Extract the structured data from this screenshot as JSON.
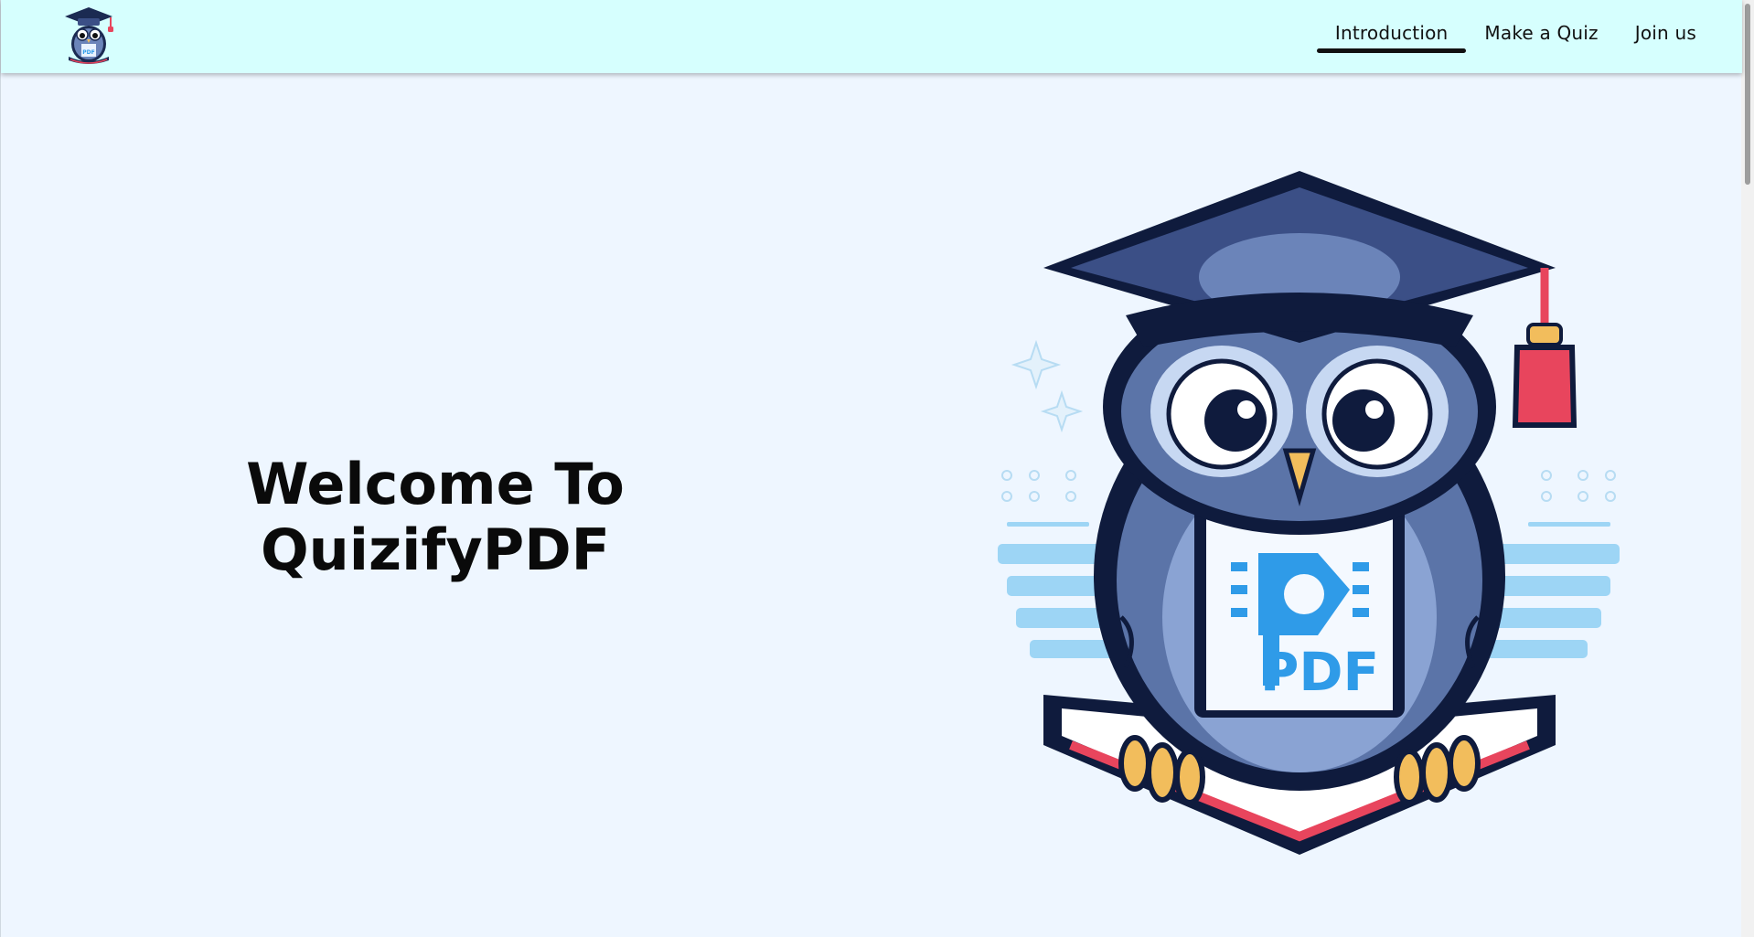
{
  "brand": {
    "logo_icon": "owl-graduate-pdf-logo",
    "logo_text": "PDF"
  },
  "nav": {
    "items": [
      {
        "label": "Introduction",
        "active": true
      },
      {
        "label": "Make a Quiz",
        "active": false
      },
      {
        "label": "Join us",
        "active": false
      }
    ]
  },
  "hero": {
    "title_line1": "Welcome To",
    "title_line2": "QuizifyPDF",
    "illustration_icon": "owl-graduate-reading-pdf-illustration",
    "illustration_text": "PDF"
  },
  "colors": {
    "header_bg": "#d6fffe",
    "page_bg": "#eef6ff",
    "navy": "#0f1b3d",
    "owl_blue": "#5b74a8",
    "accent_blue": "#2f9be8",
    "accent_red": "#e8455d",
    "claw_yellow": "#f2bd5c"
  }
}
